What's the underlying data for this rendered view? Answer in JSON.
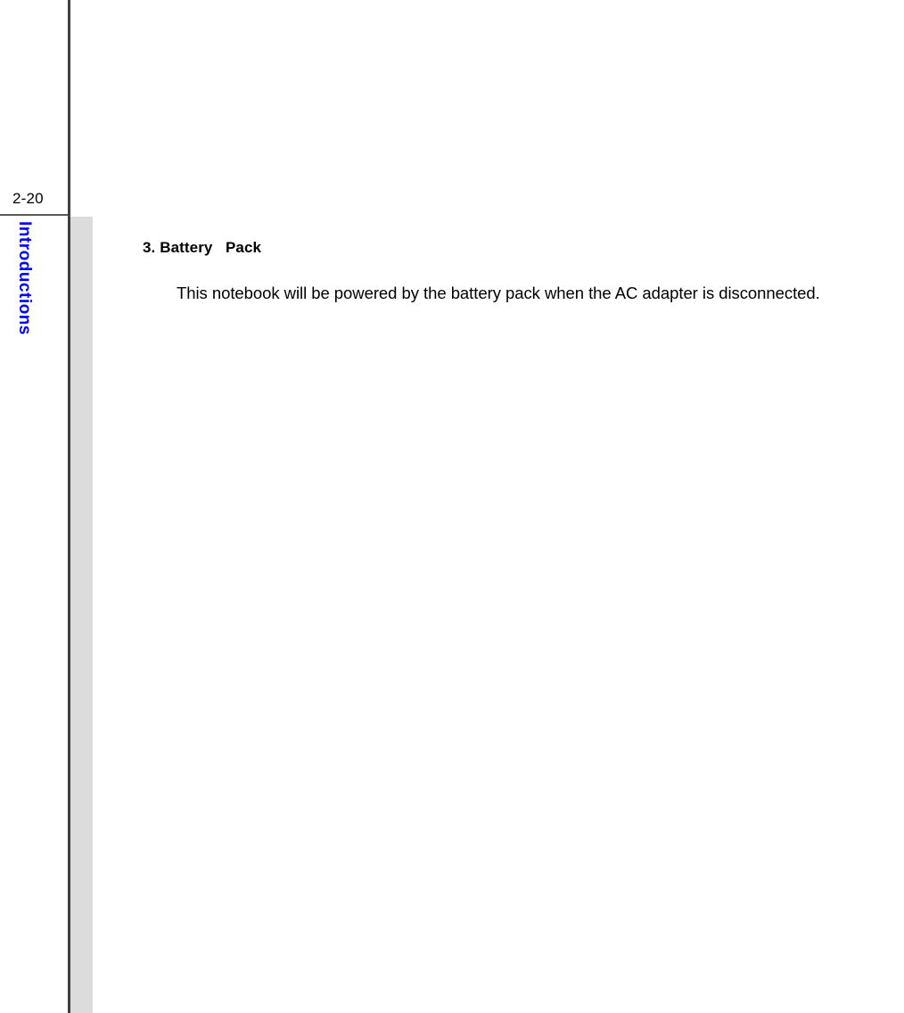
{
  "page": {
    "number": "2-20",
    "chapter_tab_label": "Introductions",
    "accent_color": "#0000FF",
    "rule_color": "#404040",
    "band_color": "#DCDCDC",
    "background_color": "#FFFFFF",
    "text_color": "#000000"
  },
  "content": {
    "section": {
      "heading": "3. Battery   Pack",
      "paragraphs": [
        "This notebook will be powered by the battery pack when the AC adapter is disconnected."
      ]
    }
  }
}
